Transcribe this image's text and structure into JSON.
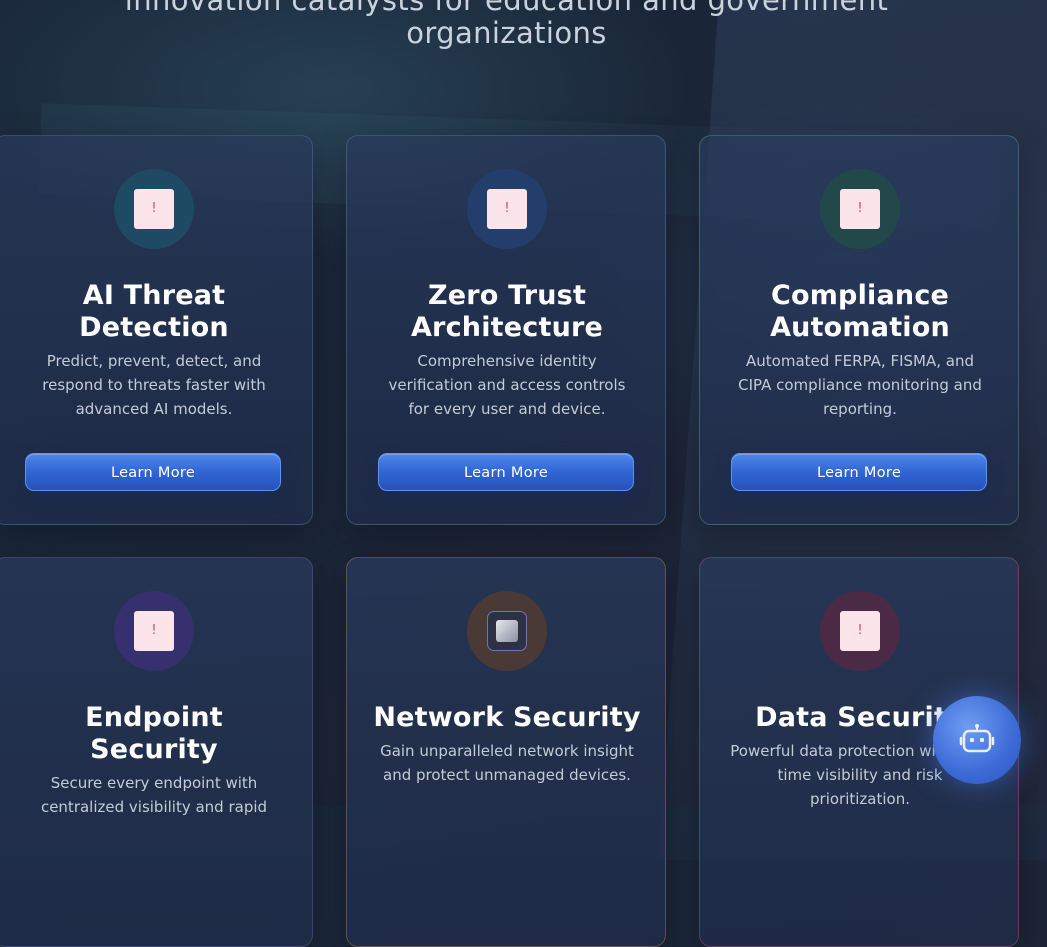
{
  "heading": {
    "line1": "innovation catalysts for education and government",
    "line2": "organizations"
  },
  "cards": [
    {
      "title_line1": "AI Threat",
      "title_line2": "Detection",
      "icon": "alert-icon",
      "icon_glyph": "!",
      "description": "Predict, prevent, detect, and respond to threats faster with advanced AI models.",
      "button_label": "Learn More"
    },
    {
      "title_line1": "Zero Trust",
      "title_line2": "Architecture",
      "icon": "alert-icon",
      "icon_glyph": "!",
      "description": "Comprehensive identity verification and access controls for every user and device.",
      "button_label": "Learn More"
    },
    {
      "title_line1": "Compliance",
      "title_line2": "Automation",
      "icon": "alert-icon",
      "icon_glyph": "!",
      "description": "Automated FERPA, FISMA, and CIPA compliance monitoring and reporting.",
      "button_label": "Learn More"
    },
    {
      "title_line1": "Endpoint",
      "title_line2": "Security",
      "icon": "alert-icon",
      "icon_glyph": "!",
      "description": "Secure every endpoint with centralized visibility and rapid"
    },
    {
      "title_line1": "Network Security",
      "icon": "device-icon",
      "description": "Gain unparalleled network insight and protect unmanaged devices."
    },
    {
      "title_line1": "Data Security",
      "icon": "alert-icon",
      "icon_glyph": "!",
      "description": "Powerful data protection with real-time visibility and risk prioritization."
    }
  ],
  "chat_button": {
    "icon": "robot-icon"
  }
}
